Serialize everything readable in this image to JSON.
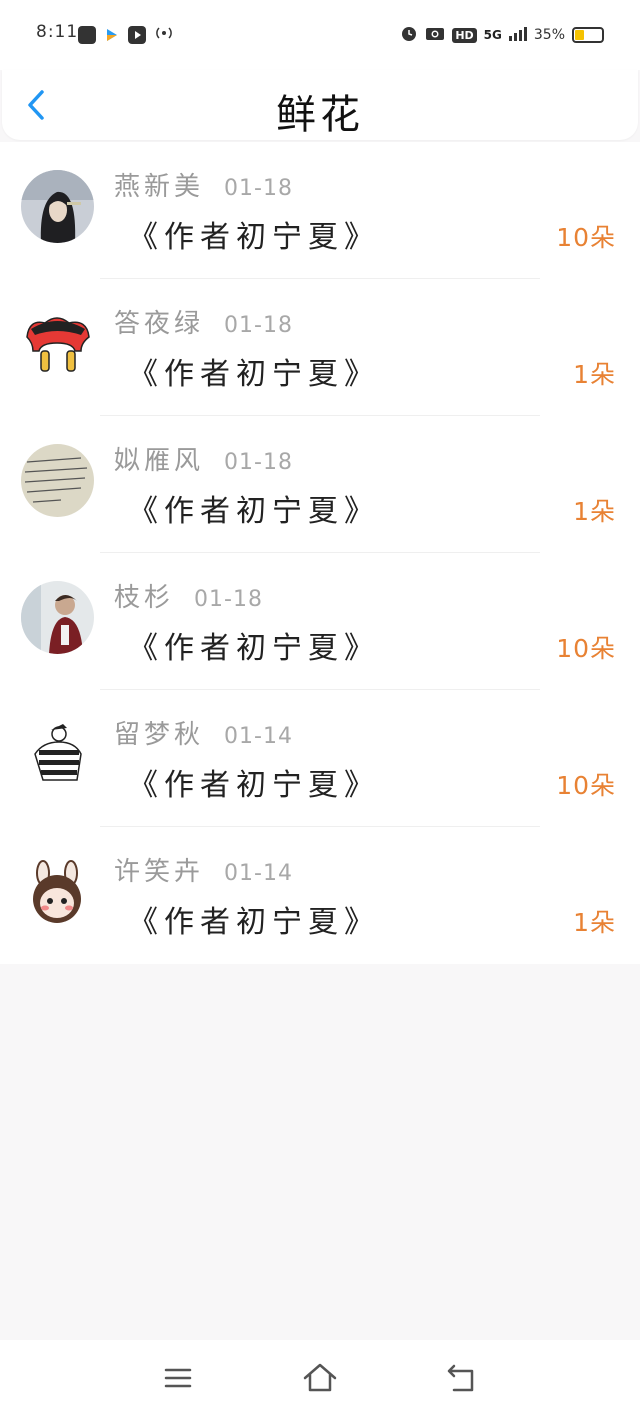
{
  "status_bar": {
    "time": "8:11",
    "network": "5G",
    "hd": "HD",
    "battery": "35%",
    "battery_level": 0.35
  },
  "header": {
    "title": "鲜花"
  },
  "items": [
    {
      "name": "燕新美",
      "date": "01-18",
      "book": "《作者初宁夏》",
      "count": "10朵"
    },
    {
      "name": "答夜绿",
      "date": "01-18",
      "book": "《作者初宁夏》",
      "count": "1朵"
    },
    {
      "name": "姒雁风",
      "date": "01-18",
      "book": "《作者初宁夏》",
      "count": "1朵"
    },
    {
      "name": "枝杉",
      "date": "01-18",
      "book": "《作者初宁夏》",
      "count": "10朵"
    },
    {
      "name": "留梦秋",
      "date": "01-14",
      "book": "《作者初宁夏》",
      "count": "10朵"
    },
    {
      "name": "许笑卉",
      "date": "01-14",
      "book": "《作者初宁夏》",
      "count": "1朵"
    }
  ],
  "colors": {
    "accent": "#2196f3",
    "count": "#e88234",
    "name": "#9a9a9a",
    "background": "#f8f7f8"
  }
}
